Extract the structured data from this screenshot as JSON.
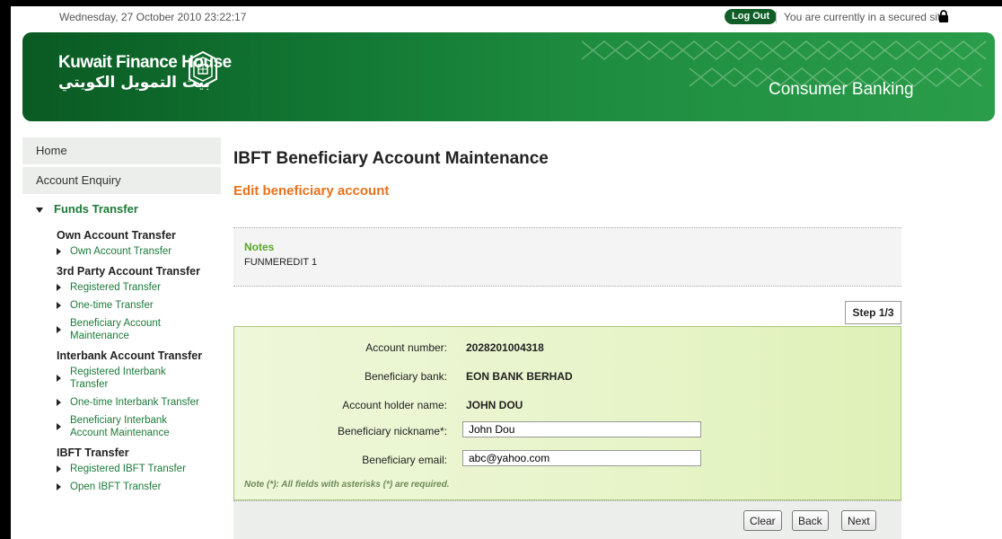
{
  "topbar": {
    "datetime": "Wednesday, 27 October 2010 23:22:17",
    "logout_label": "Log Out",
    "secure_text": "You are currently in a secured site."
  },
  "banner": {
    "brand_en": "Kuwait Finance House",
    "brand_ar": "بيت التمويل الكويتي",
    "section": "Consumer Banking"
  },
  "sidebar": {
    "home": "Home",
    "account_enquiry": "Account Enquiry",
    "funds_transfer": "Funds Transfer",
    "groups": [
      {
        "title": "Own Account Transfer",
        "links": [
          "Own Account Transfer"
        ]
      },
      {
        "title": "3rd Party Account Transfer",
        "links": [
          "Registered Transfer",
          "One-time Transfer",
          "Beneficiary Account Maintenance"
        ]
      },
      {
        "title": "Interbank Account Transfer",
        "links": [
          "Registered Interbank Transfer",
          "One-time Interbank Transfer",
          "Beneficiary Interbank Account Maintenance"
        ]
      },
      {
        "title": "IBFT Transfer",
        "links": [
          "Registered IBFT Transfer",
          "Open IBFT Transfer"
        ]
      }
    ]
  },
  "main": {
    "title": "IBFT Beneficiary Account Maintenance",
    "subtitle": "Edit beneficiary account",
    "notes_title": "Notes",
    "notes_text": "FUNMEREDIT 1",
    "step": "Step 1/3",
    "fields": {
      "account_number_label": "Account number:",
      "account_number_value": "2028201004318",
      "bank_label": "Beneficiary bank:",
      "bank_value": "EON BANK BERHAD",
      "holder_label": "Account holder name:",
      "holder_value": "JOHN DOU",
      "nickname_label": "Beneficiary nickname*:",
      "nickname_value": "John Dou",
      "email_label": "Beneficiary email:",
      "email_value": "abc@yahoo.com"
    },
    "required_note": "Note (*): All fields with asterisks (*) are required.",
    "buttons": {
      "clear": "Clear",
      "back": "Back",
      "next": "Next"
    }
  },
  "colors": {
    "brand_green": "#0f5e28",
    "link_green": "#1c7a3a",
    "accent_orange": "#e8711a",
    "notes_green": "#5aa628",
    "form_bg": "#e7f4c9"
  }
}
